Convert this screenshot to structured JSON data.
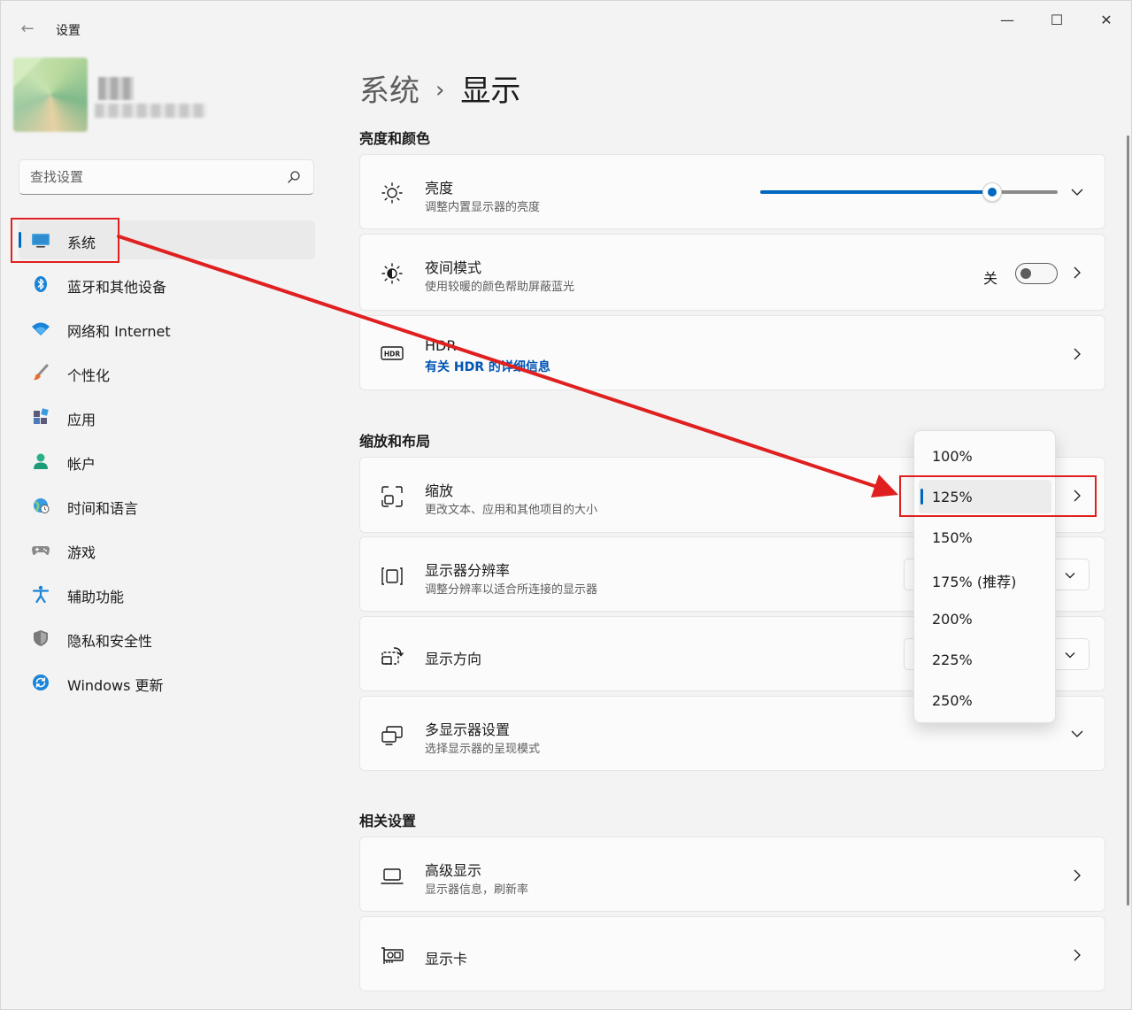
{
  "window": {
    "title": "设置",
    "back_glyph": "←",
    "min_glyph": "—",
    "max_glyph": "☐",
    "close_glyph": "✕"
  },
  "search": {
    "placeholder": "查找设置"
  },
  "nav": {
    "items": [
      {
        "label": "系统",
        "icon": "monitor-icon",
        "active": true
      },
      {
        "label": "蓝牙和其他设备",
        "icon": "bluetooth-icon"
      },
      {
        "label": "网络和 Internet",
        "icon": "wifi-icon"
      },
      {
        "label": "个性化",
        "icon": "paintbrush-icon"
      },
      {
        "label": "应用",
        "icon": "apps-icon"
      },
      {
        "label": "帐户",
        "icon": "person-icon"
      },
      {
        "label": "时间和语言",
        "icon": "globe-clock-icon"
      },
      {
        "label": "游戏",
        "icon": "gamepad-icon"
      },
      {
        "label": "辅助功能",
        "icon": "accessibility-icon"
      },
      {
        "label": "隐私和安全性",
        "icon": "shield-icon"
      },
      {
        "label": "Windows 更新",
        "icon": "refresh-icon"
      }
    ]
  },
  "breadcrumb": {
    "parent": "系统",
    "separator": "›",
    "current": "显示"
  },
  "sections": {
    "brightness_color": "亮度和颜色",
    "scale_layout": "缩放和布局",
    "related": "相关设置"
  },
  "cards": {
    "brightness": {
      "title": "亮度",
      "subtitle": "调整内置显示器的亮度",
      "value": 0.78
    },
    "night": {
      "title": "夜间模式",
      "subtitle": "使用较暖的颜色帮助屏蔽蓝光",
      "toggle_label": "关",
      "on": false
    },
    "hdr": {
      "title": "HDR",
      "link": "有关 HDR 的详细信息"
    },
    "scale": {
      "title": "缩放",
      "subtitle": "更改文本、应用和其他项目的大小"
    },
    "resolution": {
      "title": "显示器分辨率",
      "subtitle": "调整分辨率以适合所连接的显示器"
    },
    "orientation": {
      "title": "显示方向"
    },
    "multi": {
      "title": "多显示器设置",
      "subtitle": "选择显示器的呈现模式"
    },
    "advanced": {
      "title": "高级显示",
      "subtitle": "显示器信息，刷新率"
    },
    "gpu": {
      "title": "显示卡"
    }
  },
  "scale_dropdown": {
    "options": [
      "100%",
      "125%",
      "150%",
      "175% (推荐)",
      "200%",
      "225%",
      "250%"
    ],
    "selected_index": 1
  },
  "colors": {
    "accent": "#0067c0",
    "annotation": "#e02020",
    "link": "#0055b3"
  }
}
